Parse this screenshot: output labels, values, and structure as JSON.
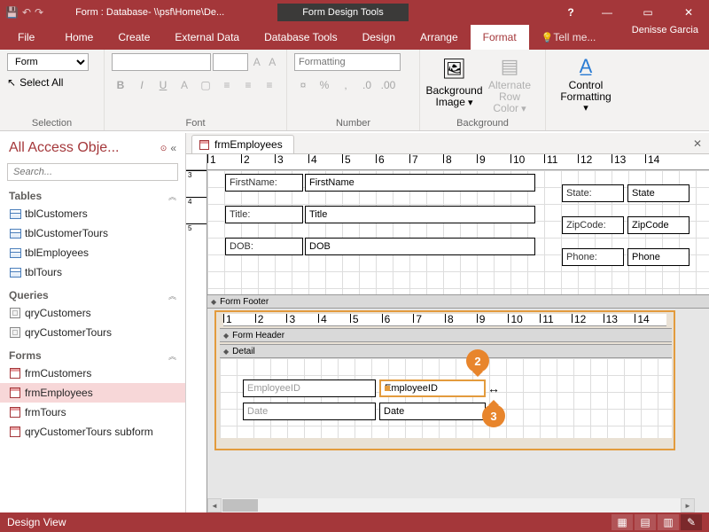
{
  "titlebar": {
    "title": "Form : Database- \\\\psf\\Home\\De...",
    "context_title": "Form Design Tools",
    "user": "Denisse Garcia"
  },
  "tabs": {
    "file": "File",
    "home": "Home",
    "create": "Create",
    "external": "External Data",
    "dbtools": "Database Tools",
    "design": "Design",
    "arrange": "Arrange",
    "format": "Format",
    "tell": "Tell me..."
  },
  "ribbon": {
    "selection": {
      "object": "Form",
      "select_all": "Select All",
      "label": "Selection"
    },
    "font": {
      "family": "",
      "size": "",
      "placeholder_fmt": "Formatting",
      "label": "Font"
    },
    "number": {
      "label": "Number"
    },
    "background": {
      "bg_image": "Background Image",
      "alt_row": "Alternate Row Color",
      "label": "Background"
    },
    "ctrl_fmt": {
      "label": "Control Formatting",
      "btn": "Control Formatting"
    }
  },
  "nav": {
    "title": "All Access Obje...",
    "search_placeholder": "Search...",
    "groups": {
      "tables": {
        "label": "Tables",
        "items": [
          "tblCustomers",
          "tblCustomerTours",
          "tblEmployees",
          "tblTours"
        ]
      },
      "queries": {
        "label": "Queries",
        "items": [
          "qryCustomers",
          "qryCustomerTours"
        ]
      },
      "forms": {
        "label": "Forms",
        "items": [
          "frmCustomers",
          "frmEmployees",
          "frmTours",
          "qryCustomerTours subform"
        ]
      }
    },
    "selected": "frmEmployees"
  },
  "doc": {
    "tab": "frmEmployees"
  },
  "form": {
    "sections": {
      "footer": "Form Footer",
      "header": "Form Header",
      "detail": "Detail"
    },
    "upper_fields": [
      {
        "label": "FirstName:",
        "bound": "FirstName"
      },
      {
        "label": "Title:",
        "bound": "Title"
      },
      {
        "label": "DOB:",
        "bound": "DOB"
      }
    ],
    "upper_right": [
      {
        "label": "State:",
        "bound": "State"
      },
      {
        "label": "ZipCode:",
        "bound": "ZipCode"
      },
      {
        "label": "Phone:",
        "bound": "Phone"
      }
    ],
    "lower_fields": [
      {
        "label": "EmployeeID",
        "bound": "EmployeeID"
      },
      {
        "label": "Date",
        "bound": "Date"
      }
    ]
  },
  "callouts": {
    "c2": "2",
    "c3": "3"
  },
  "status": {
    "mode": "Design View"
  }
}
